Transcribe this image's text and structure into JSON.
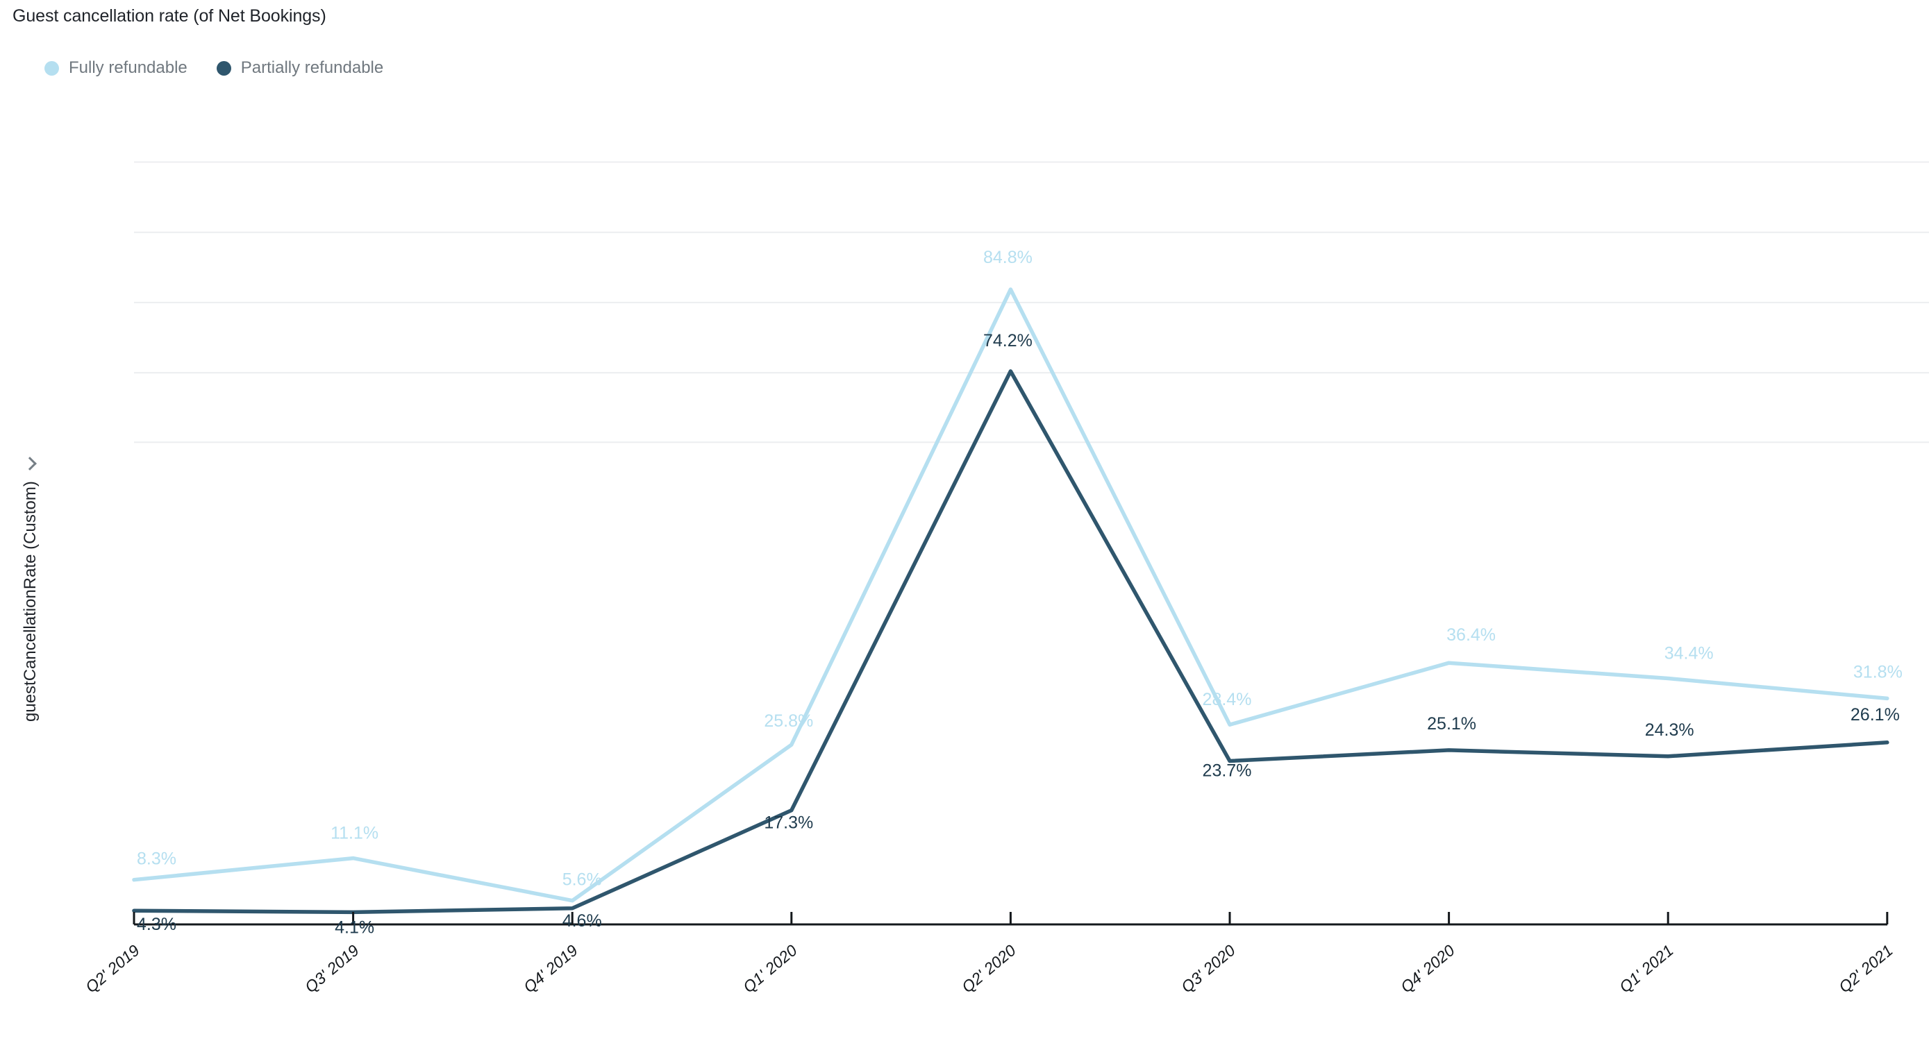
{
  "header": {
    "title": "Guest cancellation rate (of Net Bookings)"
  },
  "legend": {
    "items": [
      {
        "label": "Fully refundable",
        "color": "#b5dff0",
        "icon": "legend-dot-icon"
      },
      {
        "label": "Partially refundable",
        "color": "#2f566d",
        "icon": "legend-dot-icon"
      }
    ]
  },
  "y_axis": {
    "title": "guestCancellationRate (Custom)",
    "chevron_icon": "chevron-right-icon"
  },
  "chart_data": {
    "type": "line",
    "title": "Guest cancellation rate (of Net Bookings)",
    "xlabel": "",
    "ylabel": "guestCancellationRate (Custom)",
    "categories": [
      "Q2' 2019",
      "Q3' 2019",
      "Q4' 2019",
      "Q1' 2020",
      "Q2' 2020",
      "Q3' 2020",
      "Q4' 2020",
      "Q1' 2021",
      "Q2' 2021"
    ],
    "series": [
      {
        "name": "Fully refundable",
        "color": "#b5dff0",
        "values": [
          8.3,
          11.1,
          5.6,
          25.8,
          84.8,
          28.4,
          36.4,
          34.4,
          31.8
        ],
        "labels": [
          "8.3%",
          "11.1%",
          "5.6%",
          "25.8%",
          "84.8%",
          "28.4%",
          "36.4%",
          "34.4%",
          "31.8%"
        ]
      },
      {
        "name": "Partially refundable",
        "color": "#2f566d",
        "values": [
          4.3,
          4.1,
          4.6,
          17.3,
          74.2,
          23.7,
          25.1,
          24.3,
          26.1
        ],
        "labels": [
          "4.3%",
          "4.1%",
          "4.6%",
          "17.3%",
          "74.2%",
          "23.7%",
          "25.1%",
          "24.3%",
          "26.1%"
        ]
      }
    ],
    "ylim": [
      0,
      101
    ],
    "grid": true,
    "gridlines_y": [
      101.3,
      92.2,
      83.1,
      74.0,
      65.0
    ],
    "legend_position": "top-left",
    "value_labels_shown": true
  }
}
